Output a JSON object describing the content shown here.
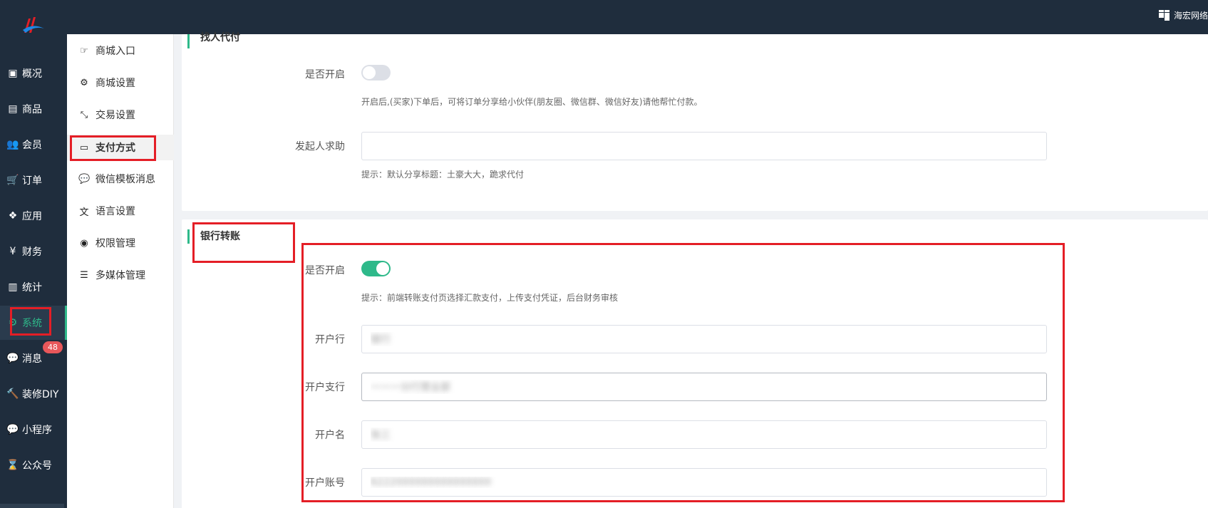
{
  "topbar": {
    "brand": "海宏网络"
  },
  "sidebar": {
    "items": [
      {
        "label": "概况",
        "icon": "window-icon"
      },
      {
        "label": "商品",
        "icon": "box-icon"
      },
      {
        "label": "会员",
        "icon": "users-icon"
      },
      {
        "label": "订单",
        "icon": "cart-icon"
      },
      {
        "label": "应用",
        "icon": "cubes-icon"
      },
      {
        "label": "财务",
        "icon": "yen-icon"
      },
      {
        "label": "统计",
        "icon": "chart-icon"
      },
      {
        "label": "系统",
        "icon": "gears-icon",
        "active": true
      },
      {
        "label": "消息",
        "icon": "comment-icon",
        "badge": "48"
      },
      {
        "label": "装修DIY",
        "icon": "hammer-icon"
      },
      {
        "label": "小程序",
        "icon": "wechat-icon"
      },
      {
        "label": "公众号",
        "icon": "hourglass-icon"
      }
    ]
  },
  "subnav": {
    "items": [
      {
        "label": "商城入口",
        "icon": "hand-point-icon"
      },
      {
        "label": "商城设置",
        "icon": "gear-icon"
      },
      {
        "label": "交易设置",
        "icon": "compress-icon"
      },
      {
        "label": "支付方式",
        "icon": "credit-card-icon",
        "active": true
      },
      {
        "label": "微信模板消息",
        "icon": "wechat-icon"
      },
      {
        "label": "语言设置",
        "icon": "language-icon"
      },
      {
        "label": "权限管理",
        "icon": "mask-icon"
      },
      {
        "label": "多媒体管理",
        "icon": "list-icon"
      }
    ]
  },
  "friend_pay": {
    "title": "找人代付",
    "enable_label": "是否开启",
    "enabled": false,
    "enable_hint": "开启后,(买家)下单后，可将订单分享给小伙伴(朋友圈、微信群、微信好友)请他帮忙付款。",
    "initiator_label": "发起人求助",
    "initiator_value": "",
    "initiator_hint": "提示：默认分享标题：土豪大大，跪求代付"
  },
  "bank_transfer": {
    "title": "银行转账",
    "enable_label": "是否开启",
    "enabled": true,
    "enable_hint": "提示：前端转账支付页选择汇款支付，上传支付凭证，后台财务审核",
    "bank_label": "开户行",
    "bank_value": "银行",
    "branch_label": "开户支行",
    "branch_value": "一一一分行营业部",
    "name_label": "开户名",
    "name_value": "张三",
    "account_label": "开户账号",
    "account_value": "6222000000000000000"
  },
  "colors": {
    "accent": "#2eb98a",
    "sidebar_bg": "#1f2d3d",
    "highlight_box": "#e41e26",
    "badge": "#e8575a"
  }
}
